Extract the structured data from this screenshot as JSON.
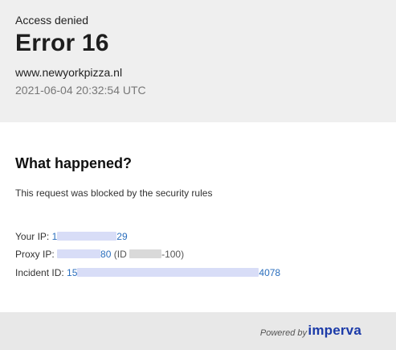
{
  "header": {
    "status": "Access denied",
    "error_title": "Error 16",
    "domain": "www.newyorkpizza.nl",
    "timestamp": "2021-06-04 20:32:54 UTC"
  },
  "details": {
    "title": "What happened?",
    "message": "This request was blocked by the security rules",
    "your_ip": {
      "label": "Your IP:",
      "prefix": "1",
      "suffix": "29"
    },
    "proxy_ip": {
      "label": "Proxy IP:",
      "suffix": "80",
      "id_open": "(ID",
      "id_close": "-100)"
    },
    "incident_id": {
      "label": "Incident ID:",
      "prefix": "15",
      "suffix": "4078"
    }
  },
  "footer": {
    "powered_by": "Powered by",
    "brand": "imperva"
  },
  "colors": {
    "background": "#efefef",
    "card": "#ffffff",
    "link": "#2a6ebd",
    "brand": "#1b3aa8"
  }
}
